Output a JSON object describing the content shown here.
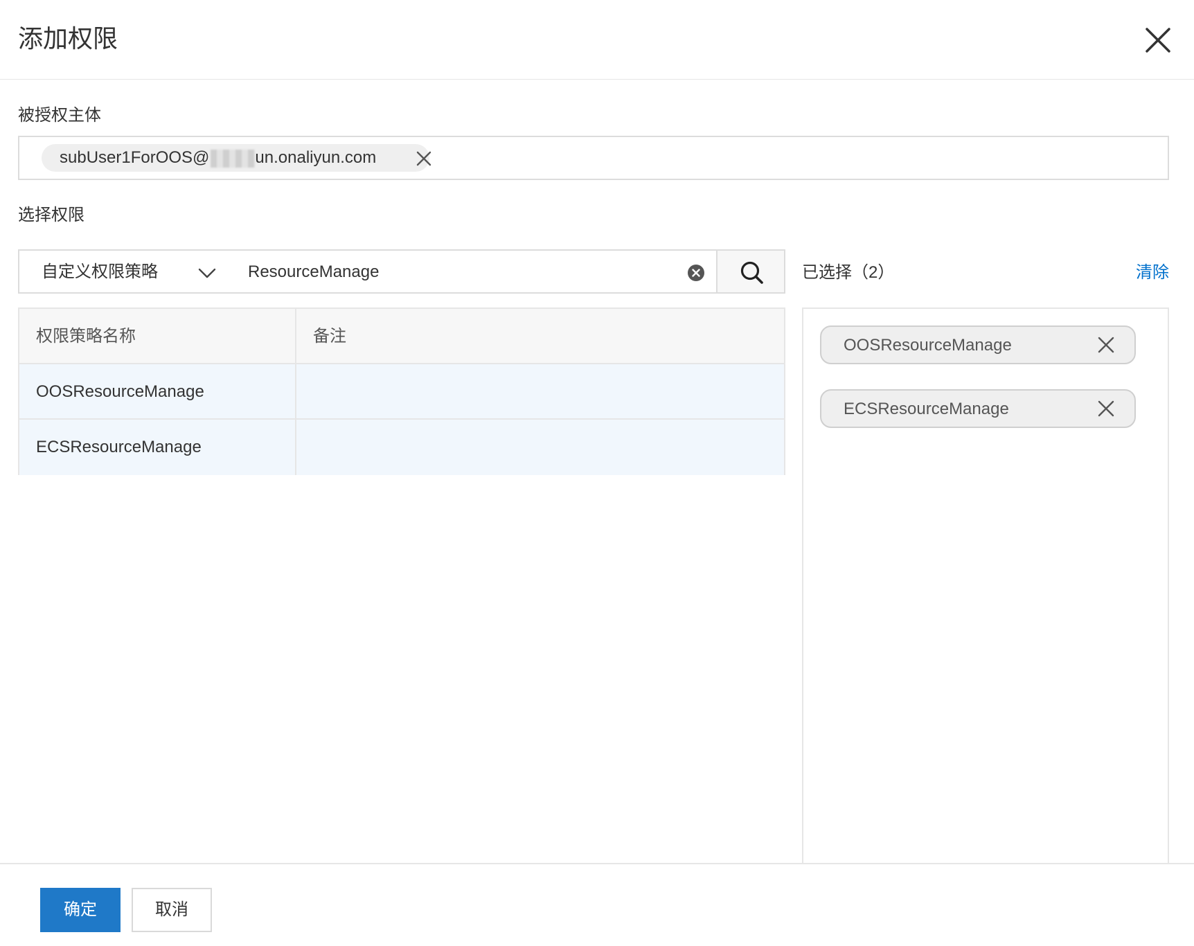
{
  "dialog": {
    "title": "添加权限"
  },
  "principal": {
    "label": "被授权主体",
    "tag_prefix": "subUser1ForOOS@",
    "tag_suffix": "un.onaliyun.com"
  },
  "permission": {
    "label": "选择权限",
    "type_select": "自定义权限策略",
    "search_value": "ResourceManage",
    "table": {
      "columns": [
        "权限策略名称",
        "备注"
      ],
      "rows": [
        {
          "name": "OOSResourceManage",
          "note": ""
        },
        {
          "name": "ECSResourceManage",
          "note": ""
        }
      ]
    }
  },
  "selected": {
    "title": "已选择（2）",
    "clear_label": "清除",
    "items": [
      "OOSResourceManage",
      "ECSResourceManage"
    ]
  },
  "footer": {
    "ok_label": "确定",
    "cancel_label": "取消"
  },
  "colors": {
    "primary": "#1f79c8",
    "link": "#0070cc",
    "row_highlight": "#f1f7fd"
  },
  "icons": [
    "close-icon",
    "chevron-down-icon",
    "clear-circle-icon",
    "search-icon",
    "remove-x-icon"
  ]
}
